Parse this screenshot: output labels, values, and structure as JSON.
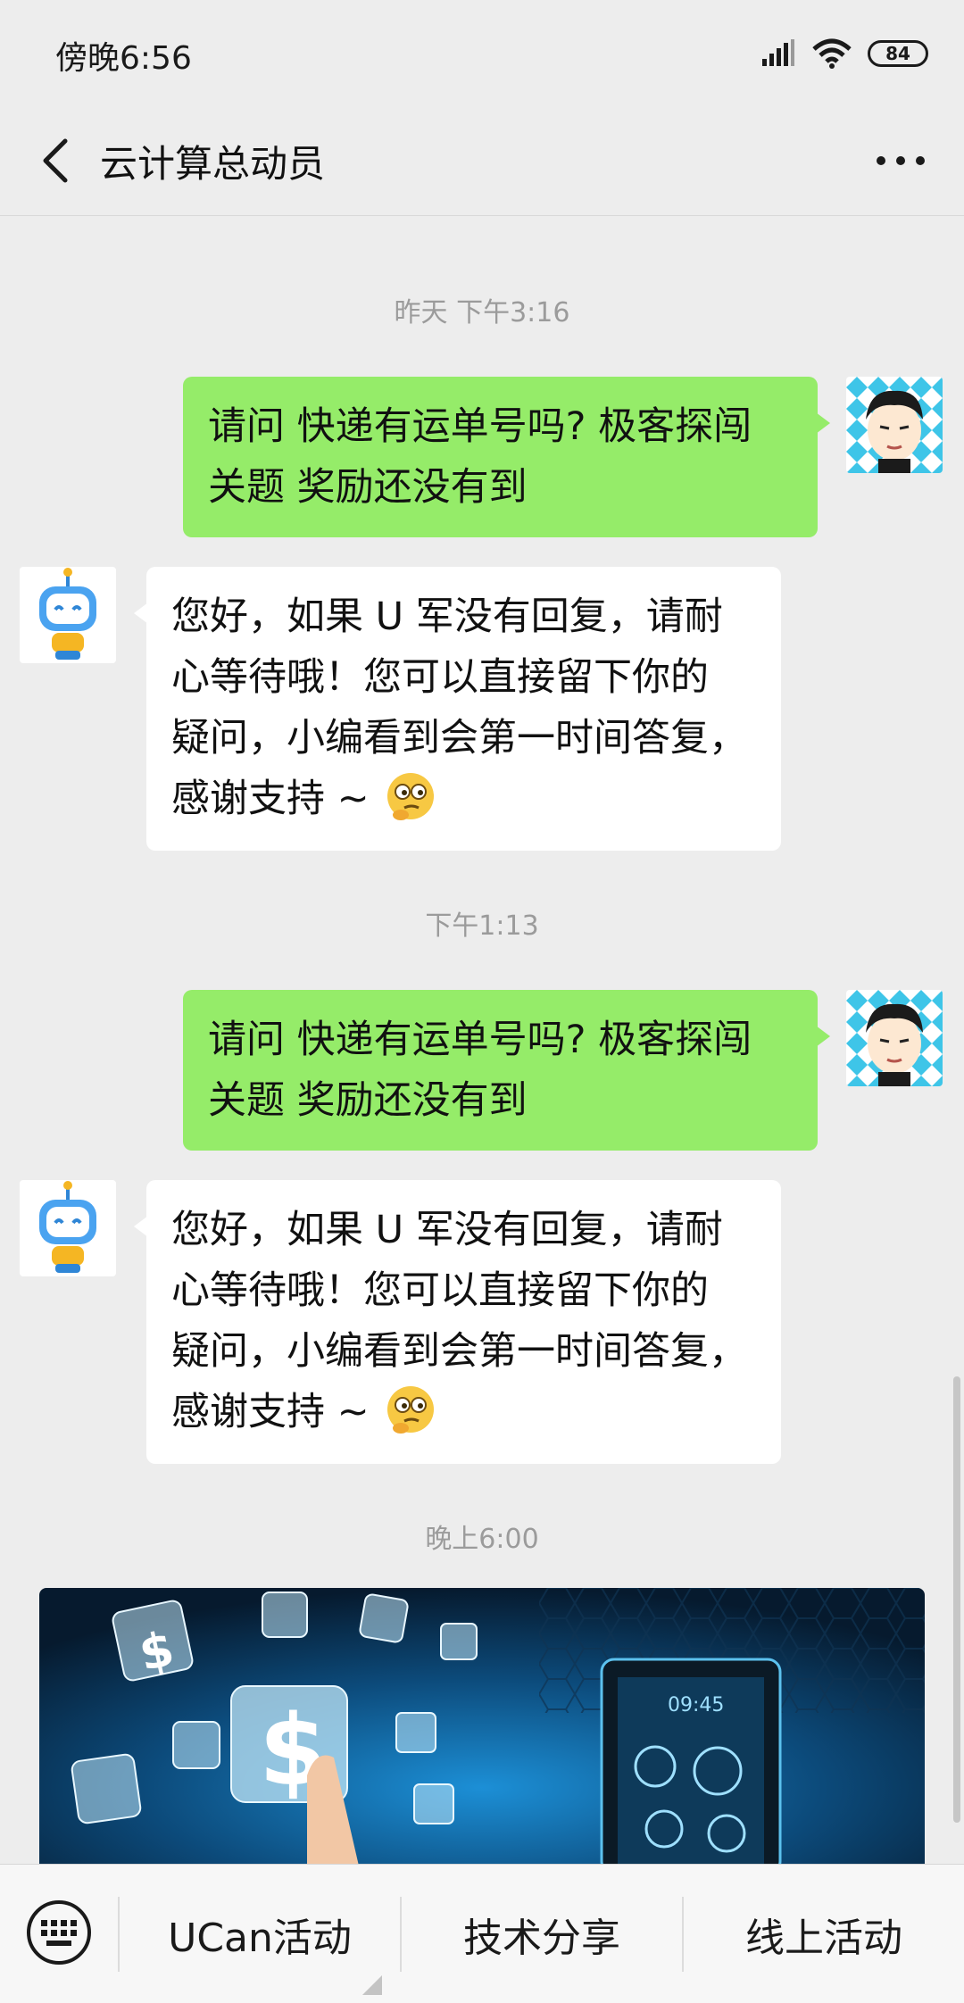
{
  "status_bar": {
    "time": "傍晚6:56",
    "battery": "84",
    "icons": [
      "signal-icon",
      "wifi-icon",
      "battery-icon"
    ]
  },
  "header": {
    "title": "云计算总动员",
    "back_icon": "chevron-left-icon",
    "more_icon": "more-icon"
  },
  "messages": {
    "ts1": "昨天 下午3:16",
    "m1_line1": "请问 快递有运单号吗? 极客探闯",
    "m1_line2": "关题 奖励还没有到",
    "r1_line1": "您好，如果 U 军没有回复，请耐",
    "r1_line2": "心等待哦！您可以直接留下你的",
    "r1_line3": "疑问，小编看到会第一时间答复，",
    "r1_line4": "感谢支持 ~",
    "ts2": "下午1:13",
    "m2_line1": "请问 快递有运单号吗? 极客探闯",
    "m2_line2": "关题 奖励还没有到",
    "r2_line1": "您好，如果 U 军没有回复，请耐",
    "r2_line2": "心等待哦！您可以直接留下你的",
    "r2_line3": "疑问，小编看到会第一时间答复，",
    "r2_line4": "感谢支持 ~",
    "ts3": "晚上6:00",
    "card_phone_time": "09:45"
  },
  "bottom_menu": {
    "keyboard_icon": "keyboard-icon",
    "item1": "UCan活动",
    "item2": "技术分享",
    "item3": "线上活动"
  },
  "colors": {
    "background": "#ededed",
    "outgoing_bubble": "#95ec69",
    "incoming_bubble": "#ffffff",
    "timestamp": "#9b9b9b"
  }
}
